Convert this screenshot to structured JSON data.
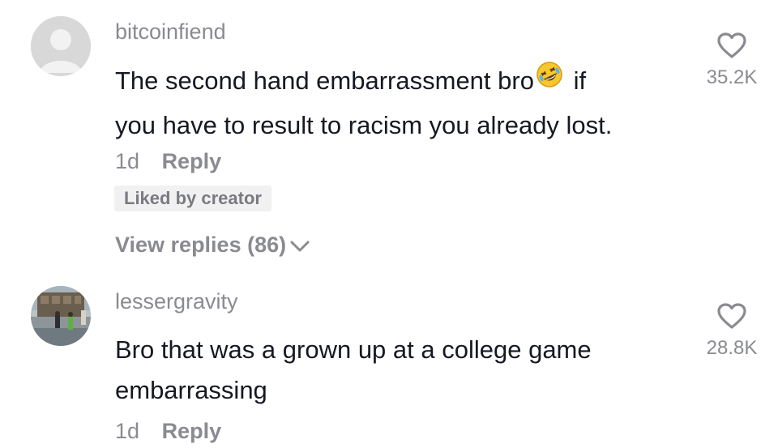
{
  "comments": [
    {
      "username": "bitcoinfiend",
      "text_part1": "The second hand embarrassment bro",
      "emoji": "rolling-on-floor-laughing",
      "text_part2": " if",
      "text_line2": "you have to result to racism you already lost.",
      "time": "1d",
      "reply_label": "Reply",
      "badge": "Liked by creator",
      "view_replies": "View replies (86)",
      "like_count": "35.2K"
    },
    {
      "username": "lessergravity",
      "text_line1": "Bro that was a grown up at a college game",
      "text_line2": "embarrassing",
      "time": "1d",
      "reply_label": "Reply",
      "like_count": "28.8K"
    }
  ],
  "colors": {
    "secondary_text": "#8a8b91",
    "primary_text": "#161823",
    "badge_bg": "#f1f1f2"
  }
}
